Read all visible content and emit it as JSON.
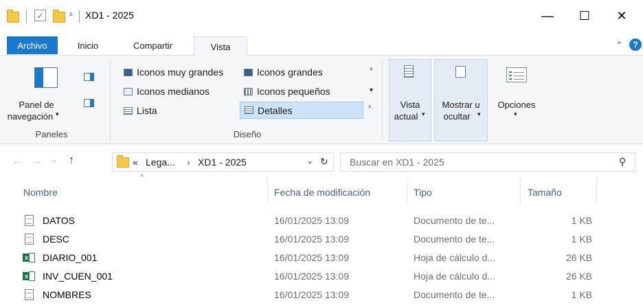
{
  "titlebar": {
    "title": "XD1 - 2025",
    "minimize_glyph": "—",
    "maximize_glyph": "☐",
    "close_glyph": "✕"
  },
  "tabs": [
    {
      "label": "Archivo"
    },
    {
      "label": "Inicio"
    },
    {
      "label": "Compartir"
    },
    {
      "label": "Vista"
    }
  ],
  "ribbon": {
    "paneles": {
      "panel_label_1": "Panel de",
      "panel_label_2": "navegación",
      "group_label": "Paneles"
    },
    "diseno": {
      "items": [
        {
          "label": "Iconos muy grandes"
        },
        {
          "label": "Iconos grandes"
        },
        {
          "label": "Iconos medianos"
        },
        {
          "label": "Iconos pequeños"
        },
        {
          "label": "Lista"
        },
        {
          "label": "Detalles"
        }
      ],
      "group_label": "Diseño"
    },
    "vista_actual": {
      "line1": "Vista",
      "line2": "actual"
    },
    "mostrar": {
      "line1": "Mostrar u",
      "line2": "ocultar"
    },
    "opciones": {
      "label": "Opciones"
    }
  },
  "address": {
    "prefix": "«",
    "crumb1": "Lega...",
    "sep": "›",
    "crumb2": "XD1 - 2025"
  },
  "search": {
    "placeholder": "Buscar en XD1 - 2025"
  },
  "columns": {
    "name": "Nombre",
    "date": "Fecha de modificación",
    "type": "Tipo",
    "size": "Tamaño"
  },
  "files": [
    {
      "name": "DATOS",
      "date": "16/01/2025 13:09",
      "type": "Documento de te...",
      "size": "1 KB",
      "icon": "text-file-icon"
    },
    {
      "name": "DESC",
      "date": "16/01/2025 13:09",
      "type": "Documento de te...",
      "size": "1 KB",
      "icon": "text-file-icon"
    },
    {
      "name": "DIARIO_001",
      "date": "16/01/2025 13:09",
      "type": "Hoja de cálculo d...",
      "size": "26 KB",
      "icon": "spreadsheet-file-icon"
    },
    {
      "name": "INV_CUEN_001",
      "date": "16/01/2025 13:09",
      "type": "Hoja de cálculo d...",
      "size": "26 KB",
      "icon": "spreadsheet-file-icon"
    },
    {
      "name": "NOMBRES",
      "date": "16/01/2025 13:09",
      "type": "Documento de te...",
      "size": "1 KB",
      "icon": "text-file-icon"
    }
  ],
  "colors": {
    "archivo_tab": "#1979ca",
    "selected_layout": "#cce4f7",
    "ribbon_bg": "#f5f6f7",
    "column_header": "#4c607a"
  }
}
